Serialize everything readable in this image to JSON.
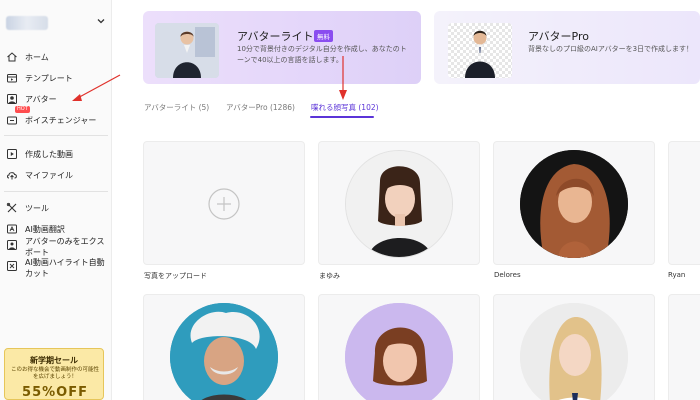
{
  "sidebar": {
    "items": [
      {
        "label": "ホーム",
        "icon": "home-icon"
      },
      {
        "label": "テンプレート",
        "icon": "template-icon"
      },
      {
        "label": "アバター",
        "icon": "avatar-icon"
      },
      {
        "label": "ボイスチェンジャー",
        "icon": "voice-changer-icon",
        "badge": "HOT"
      },
      {
        "label": "作成した動画",
        "icon": "video-play-icon"
      },
      {
        "label": "マイファイル",
        "icon": "upload-cloud-icon"
      },
      {
        "label": "ツール",
        "icon": "tools-icon"
      },
      {
        "label": "AI動画翻訳",
        "icon": "translate-icon"
      },
      {
        "label": "アバターのみをエクスポート",
        "icon": "export-icon"
      },
      {
        "label": "AI動画ハイライト自動カット",
        "icon": "highlight-cut-icon"
      }
    ],
    "promo": {
      "title": "新学期セール",
      "subtitle": "このお得な機会で動画制作の可能性を広げましょう！",
      "big": "55%OFF"
    }
  },
  "banners": {
    "lite": {
      "title": "アバターライト",
      "badge": "無料",
      "desc": "10分で背景付きのデジタル自分を作成し、あなたのトーンで40以上の言語を話します。"
    },
    "pro": {
      "title": "アバターPro",
      "desc": "背景なしのプロ級のAIアバターを3日で作成します！"
    }
  },
  "tabs": [
    {
      "label": "アバターライト (5)"
    },
    {
      "label": "アバターPro (1286)"
    },
    {
      "label": "喋れる顔写真 (102)"
    }
  ],
  "cards": [
    {
      "name": "写真をアップロード"
    },
    {
      "name": "まゆみ"
    },
    {
      "name": "Delores"
    },
    {
      "name": "Ryan"
    }
  ],
  "colors": {
    "accent": "#5b34d8",
    "badge": "#8a4cf0",
    "annotation": "#e0312b"
  }
}
